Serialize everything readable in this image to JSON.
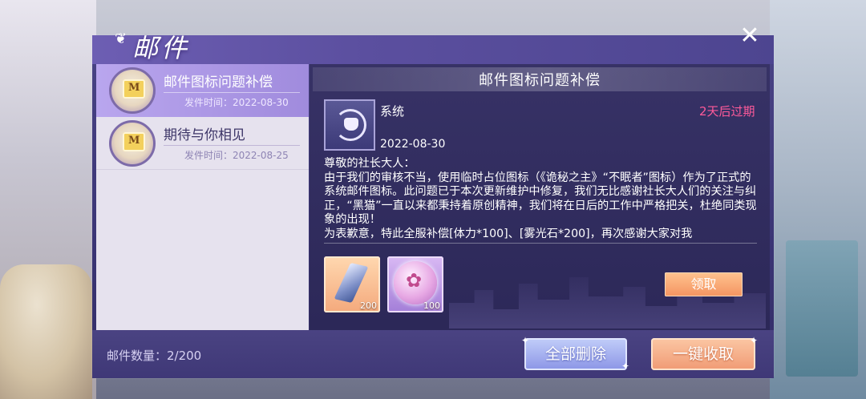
{
  "window": {
    "title": "邮件",
    "close_glyph": "✕"
  },
  "mail_list": [
    {
      "subject": "邮件图标问题补偿",
      "date": "发件时间：2022-08-30",
      "selected": true
    },
    {
      "subject": "期待与你相见",
      "date": "发件时间：2022-08-25",
      "selected": false
    }
  ],
  "detail": {
    "title": "邮件图标问题补偿",
    "sender": "系统",
    "date": "2022-08-30",
    "expire": "2天后过期",
    "body": "尊敬的社长大人：\n由于我们的审核不当，使用临时占位图标（《诡秘之主》“不眠者”图标）作为了正式的系统邮件图标。此问题已于本次更新维护中修复，我们无比感谢社长大人们的关注与纠正，“黑猫”一直以来都秉持着原创精神，我们将在日后的工作中严格把关，杜绝同类现象的出现！\n为表歉意，特此全服补偿[体力*100]、[雾光石*200]，再次感谢大家对我",
    "rewards": [
      {
        "icon": "crystal-icon",
        "count": "200"
      },
      {
        "icon": "orb-icon",
        "count": "100"
      }
    ],
    "claim_label": "领取"
  },
  "footer": {
    "count_label": "邮件数量：2/200",
    "delete_all_label": "全部删除",
    "collect_all_label": "一键收取"
  },
  "colors": {
    "panel": "#3b3575",
    "selected_item": "#a08bdd",
    "expire_text": "#ff5a9a",
    "claim_button": "#f49461",
    "delete_button": "#8b95e6"
  }
}
